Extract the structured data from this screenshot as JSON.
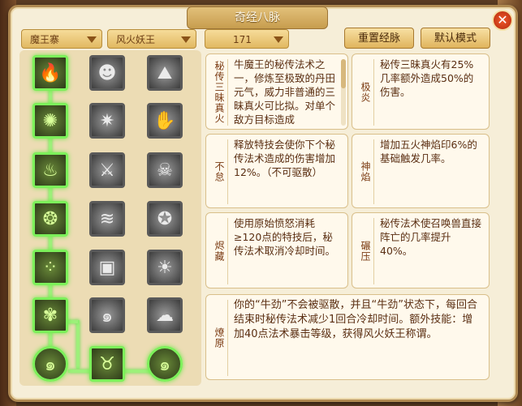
{
  "title": "奇经八脉",
  "close_label": "✕",
  "dropdowns": [
    {
      "label": "魔王寨"
    },
    {
      "label": "风火妖王"
    },
    {
      "label": "171"
    }
  ],
  "buttons": {
    "reset": "重置经脉",
    "default_mode": "默认模式"
  },
  "tree": {
    "rows": [
      [
        "fire-icon",
        "demon-face-icon",
        "mountain-icon"
      ],
      [
        "flame-icon",
        "spark-icon",
        "hand-icon"
      ],
      [
        "torch-icon",
        "cross-swords-icon",
        "skull-icon"
      ],
      [
        "seal-icon",
        "wave-icon",
        "compass-icon"
      ],
      [
        "dots-icon",
        "stones-icon",
        "sun-burst-icon"
      ],
      [
        "beast-icon",
        "swirl-icon",
        "cloud-icon"
      ]
    ],
    "bottom": [
      "swirl-orb-icon",
      "horned-demon-icon",
      "swirl-orb-icon"
    ]
  },
  "skills": [
    {
      "name": "秘传三昧真火",
      "desc": "牛魔王的秘传法术之一，修炼至极致的丹田元气，威力非普通的三昧真火可比拟。对单个敌方目标造成"
    },
    {
      "name": "极炎",
      "desc": "秘传三昧真火有25%几率额外造成50%的伤害。"
    },
    {
      "name": "不怠",
      "desc": "释放特技会使你下个秘传法术造成的伤害增加12%。（不可驱散）"
    },
    {
      "name": "神焰",
      "desc": "增加五火神焰印6%的基础触发几率。"
    },
    {
      "name": "烬藏",
      "desc": "使用原始愤怒消耗≥120点的特技后，秘传法术取消冷却时间。"
    },
    {
      "name": "碾压",
      "desc": "秘传法术使召唤兽直接阵亡的几率提升40%。"
    },
    {
      "name": "燎原",
      "desc": "你的“牛劲”不会被驱散，并且“牛劲”状态下，每回合结束时秘传法术减少1回合冷却时间。额外技能：增加40点法术暴击等级，获得风火妖王称谓。"
    }
  ]
}
